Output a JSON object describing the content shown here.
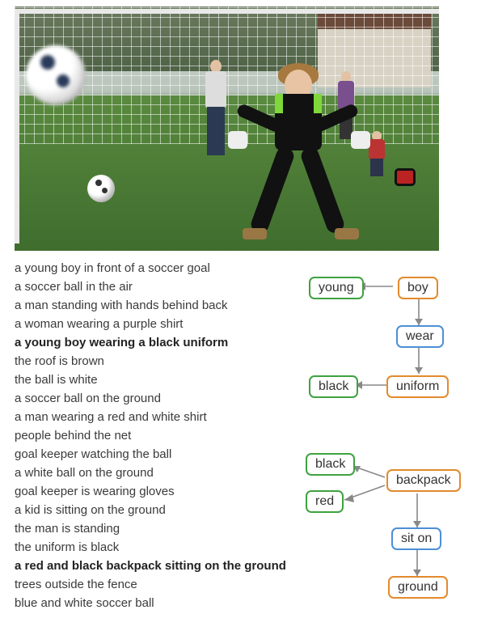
{
  "captions": [
    {
      "text": "a young boy in front of a soccer goal",
      "bold": false
    },
    {
      "text": "a soccer ball in the air",
      "bold": false
    },
    {
      "text": "a man standing with hands behind back",
      "bold": false
    },
    {
      "text": "a woman wearing a purple shirt",
      "bold": false
    },
    {
      "text": "a young boy wearing a black uniform",
      "bold": true
    },
    {
      "text": "the roof is brown",
      "bold": false
    },
    {
      "text": "the ball is white",
      "bold": false
    },
    {
      "text": "a soccer ball on the ground",
      "bold": false
    },
    {
      "text": "a man wearing a red and white shirt",
      "bold": false
    },
    {
      "text": "people behind the net",
      "bold": false
    },
    {
      "text": "goal keeper watching the ball",
      "bold": false
    },
    {
      "text": "a white ball on the ground",
      "bold": false
    },
    {
      "text": "goal keeper is wearing gloves",
      "bold": false
    },
    {
      "text": "a kid is sitting on the ground",
      "bold": false
    },
    {
      "text": "the man is standing",
      "bold": false
    },
    {
      "text": "the uniform is black",
      "bold": false
    },
    {
      "text": "a red and black backpack sitting on the ground",
      "bold": true
    },
    {
      "text": "trees outside the fence",
      "bold": false
    },
    {
      "text": "blue and white soccer ball",
      "bold": false
    }
  ],
  "graph1": {
    "young": "young",
    "boy": "boy",
    "wear": "wear",
    "black": "black",
    "uniform": "uniform"
  },
  "graph2": {
    "black": "black",
    "red": "red",
    "backpack": "backpack",
    "siton": "sit on",
    "ground": "ground"
  }
}
